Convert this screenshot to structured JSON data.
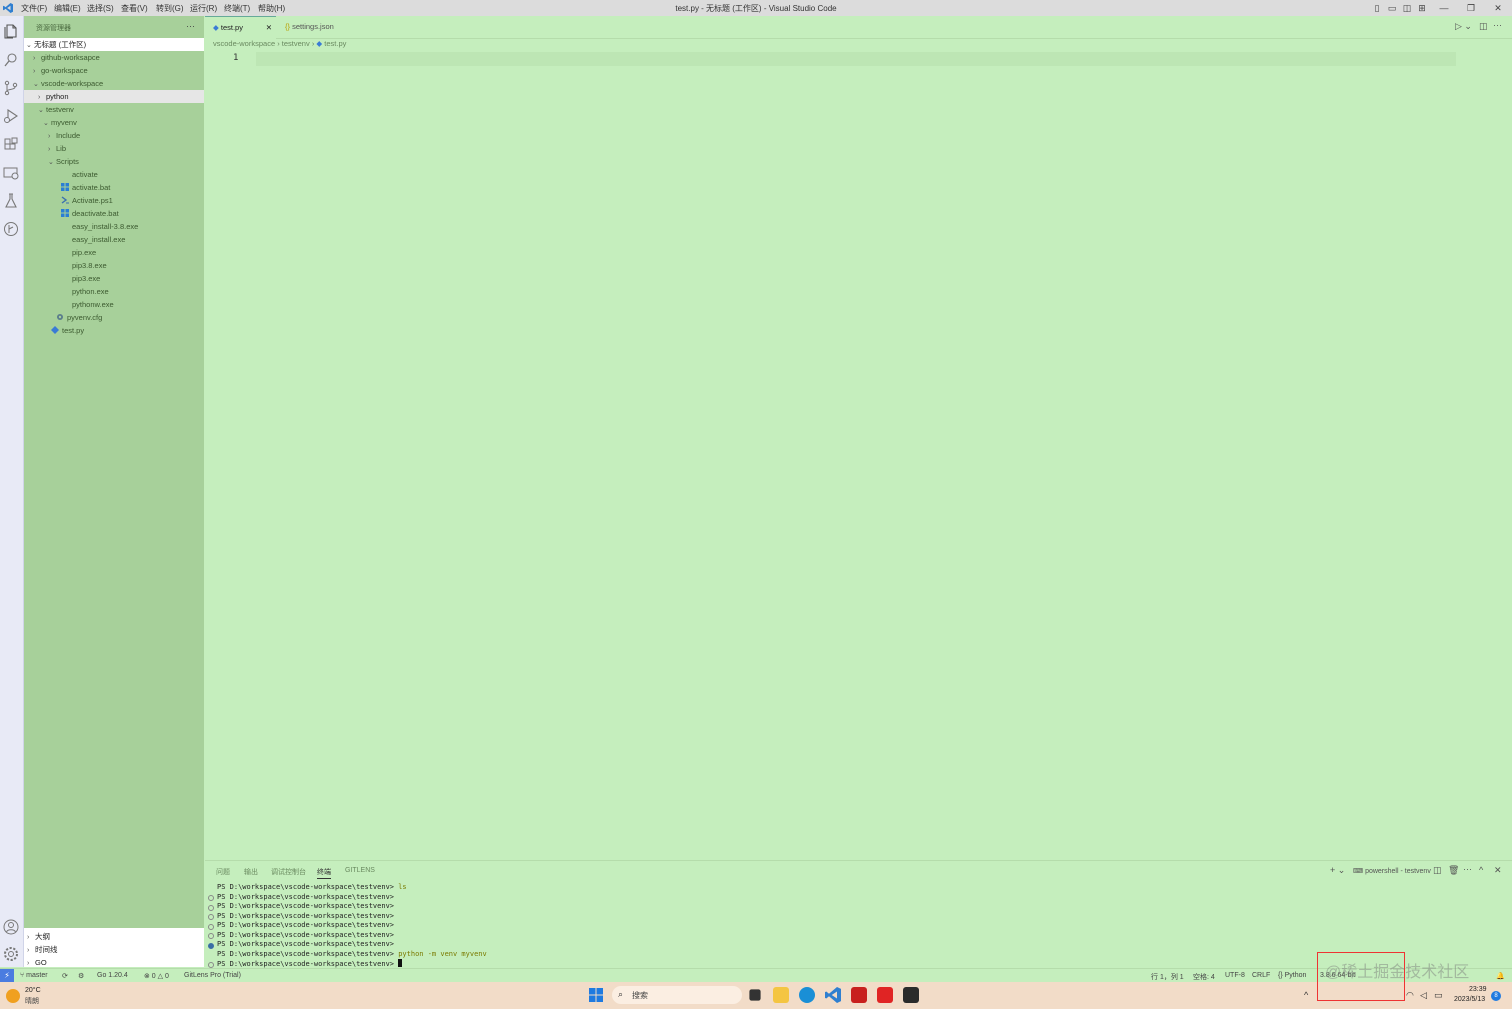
{
  "window": {
    "title": "test.py - 无标题 (工作区) - Visual Studio Code",
    "menu": [
      "文件(F)",
      "编辑(E)",
      "选择(S)",
      "查看(V)",
      "转到(G)",
      "运行(R)",
      "终端(T)",
      "帮助(H)"
    ]
  },
  "sidebar": {
    "header": "资源管理器",
    "more": "···",
    "workspace": "无标题 (工作区)",
    "tree": [
      {
        "label": "github-worksapce",
        "depth": 1,
        "chev": "›"
      },
      {
        "label": "go-workspace",
        "depth": 1,
        "chev": "›"
      },
      {
        "label": "vscode-workspace",
        "depth": 1,
        "chev": "⌄"
      },
      {
        "label": "python",
        "depth": 2,
        "chev": "›",
        "selected": true
      },
      {
        "label": "testvenv",
        "depth": 2,
        "chev": "⌄"
      },
      {
        "label": "myvenv",
        "depth": 3,
        "chev": "⌄"
      },
      {
        "label": "Include",
        "depth": 4,
        "chev": "›"
      },
      {
        "label": "Lib",
        "depth": 4,
        "chev": "›"
      },
      {
        "label": "Scripts",
        "depth": 4,
        "chev": "⌄"
      },
      {
        "label": "activate",
        "depth": 5,
        "chev": "",
        "icon": "none"
      },
      {
        "label": "activate.bat",
        "depth": 5,
        "chev": "",
        "icon": "win"
      },
      {
        "label": "Activate.ps1",
        "depth": 5,
        "chev": "",
        "icon": "ps"
      },
      {
        "label": "deactivate.bat",
        "depth": 5,
        "chev": "",
        "icon": "win"
      },
      {
        "label": "easy_install-3.8.exe",
        "depth": 5,
        "chev": "",
        "icon": "none"
      },
      {
        "label": "easy_install.exe",
        "depth": 5,
        "chev": "",
        "icon": "none"
      },
      {
        "label": "pip.exe",
        "depth": 5,
        "chev": "",
        "icon": "none"
      },
      {
        "label": "pip3.8.exe",
        "depth": 5,
        "chev": "",
        "icon": "none"
      },
      {
        "label": "pip3.exe",
        "depth": 5,
        "chev": "",
        "icon": "none"
      },
      {
        "label": "python.exe",
        "depth": 5,
        "chev": "",
        "icon": "none"
      },
      {
        "label": "pythonw.exe",
        "depth": 5,
        "chev": "",
        "icon": "none"
      },
      {
        "label": "pyvenv.cfg",
        "depth": 4,
        "chev": "",
        "icon": "gear"
      },
      {
        "label": "test.py",
        "depth": 3,
        "chev": "",
        "icon": "py"
      }
    ],
    "bottom": [
      "大纲",
      "时间线",
      "GO"
    ]
  },
  "tabs": [
    {
      "label": "test.py",
      "active": true,
      "close": "✕"
    },
    {
      "label": "settings.json",
      "active": false,
      "close": ""
    }
  ],
  "breadcrumb": [
    "vscode-workspace",
    "testvenv",
    "test.py"
  ],
  "editor": {
    "line_number": "1"
  },
  "panel": {
    "tabs": [
      "问题",
      "输出",
      "调试控制台",
      "终端",
      "GITLENS"
    ],
    "active_tab": "终端",
    "terminal_name": "powershell - testvenv",
    "lines": [
      {
        "prompt": "PS D:\\workspace\\vscode-workspace\\testvenv> ",
        "cmd": "ls",
        "dot": "none"
      },
      {
        "prompt": "PS D:\\workspace\\vscode-workspace\\testvenv>",
        "cmd": "",
        "dot": "hollow"
      },
      {
        "prompt": "PS D:\\workspace\\vscode-workspace\\testvenv>",
        "cmd": "",
        "dot": "hollow"
      },
      {
        "prompt": "PS D:\\workspace\\vscode-workspace\\testvenv>",
        "cmd": "",
        "dot": "hollow"
      },
      {
        "prompt": "PS D:\\workspace\\vscode-workspace\\testvenv>",
        "cmd": "",
        "dot": "hollow"
      },
      {
        "prompt": "PS D:\\workspace\\vscode-workspace\\testvenv>",
        "cmd": "",
        "dot": "hollow"
      },
      {
        "prompt": "PS D:\\workspace\\vscode-workspace\\testvenv>",
        "cmd": "",
        "dot": "filled"
      },
      {
        "prompt": "PS D:\\workspace\\vscode-workspace\\testvenv> ",
        "cmd": "python -m venv myvenv",
        "dot": "none"
      },
      {
        "prompt": "PS D:\\workspace\\vscode-workspace\\testvenv> ",
        "cmd": "",
        "dot": "hollow"
      }
    ]
  },
  "statusbar": {
    "remote": "⚡",
    "branch": "master",
    "go_version": "Go 1.20.4",
    "problems": "⊗ 0 △ 0",
    "gitlens": "GitLens Pro (Trial)",
    "position": "行 1，列 1",
    "spaces": "空格: 4",
    "encoding": "UTF-8",
    "eol": "CRLF",
    "language": "Python",
    "python_version": "3.8.6 64-bit"
  },
  "taskbar": {
    "weather_temp": "20°C",
    "weather_desc": "晴朗",
    "search": "搜索",
    "time": "23:39",
    "date": "2023/5/13",
    "notif_count": "8"
  },
  "watermark": "@稀土掘金技术社区",
  "colors": {
    "accent": "#4a7ce0",
    "editor_bg": "#c5eebd",
    "sidebar_bg": "#a7d09a"
  }
}
